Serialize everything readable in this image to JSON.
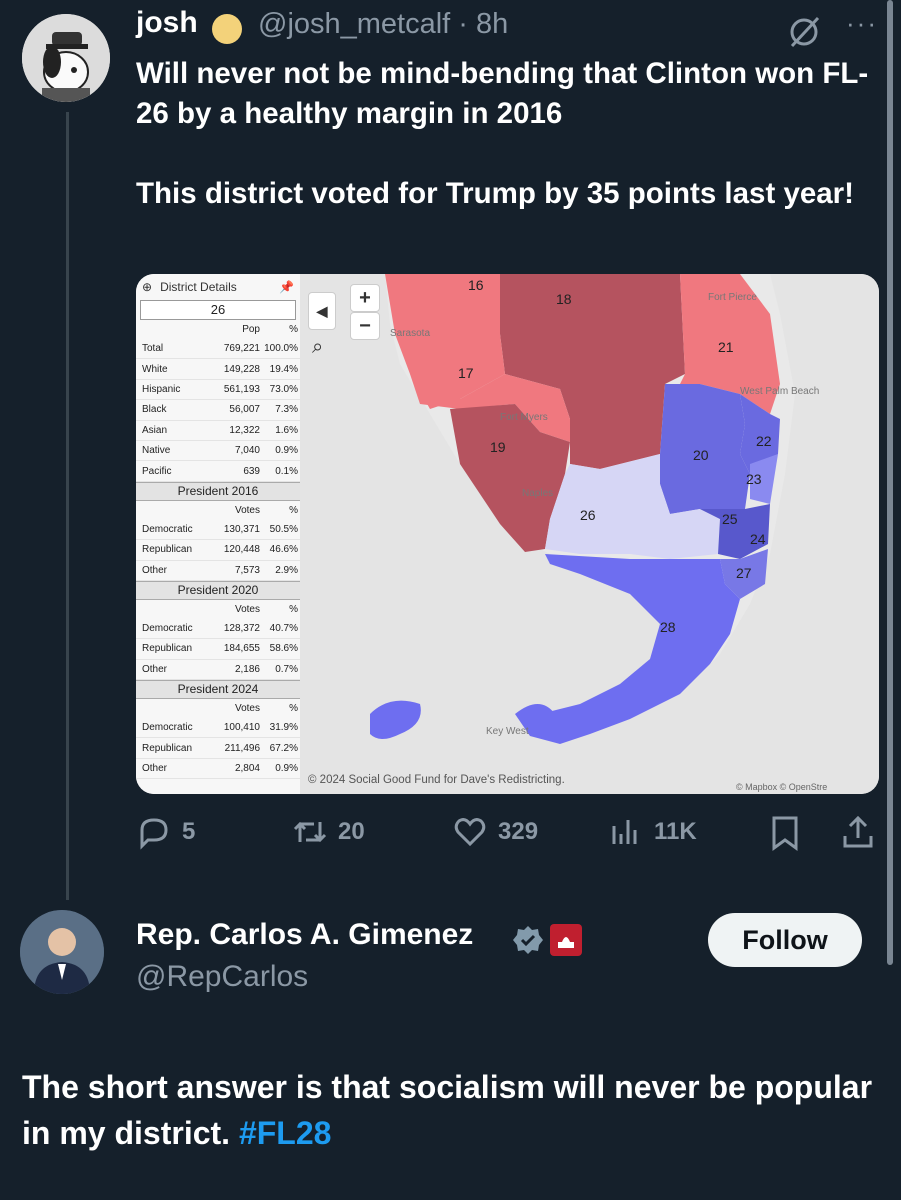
{
  "tweet1": {
    "author_name": "josh",
    "handle_time": "@josh_metcalf · 8h",
    "text": "Will never not be mind-bending that Clinton won FL-26 by a healthy margin in 2016\n\nThis district voted for Trump by 35 points last year!",
    "more_label": "···",
    "actions": {
      "replies": "5",
      "reposts": "20",
      "likes": "329",
      "views": "11K"
    }
  },
  "district_details": {
    "title": "District Details",
    "district": "26",
    "pop_headers": [
      "Pop",
      "%"
    ],
    "pop_rows": [
      [
        "Total",
        "769,221",
        "100.0%"
      ],
      [
        "White",
        "149,228",
        "19.4%"
      ],
      [
        "Hispanic",
        "561,193",
        "73.0%"
      ],
      [
        "Black",
        "56,007",
        "7.3%"
      ],
      [
        "Asian",
        "12,322",
        "1.6%"
      ],
      [
        "Native",
        "7,040",
        "0.9%"
      ],
      [
        "Pacific",
        "639",
        "0.1%"
      ]
    ],
    "elections": [
      {
        "title": "President 2016",
        "headers": [
          "Votes",
          "%"
        ],
        "rows": [
          [
            "Democratic",
            "130,371",
            "50.5%"
          ],
          [
            "Republican",
            "120,448",
            "46.6%"
          ],
          [
            "Other",
            "7,573",
            "2.9%"
          ]
        ]
      },
      {
        "title": "President 2020",
        "headers": [
          "Votes",
          "%"
        ],
        "rows": [
          [
            "Democratic",
            "128,372",
            "40.7%"
          ],
          [
            "Republican",
            "184,655",
            "58.6%"
          ],
          [
            "Other",
            "2,186",
            "0.7%"
          ]
        ]
      },
      {
        "title": "President 2024",
        "headers": [
          "Votes",
          "%"
        ],
        "rows": [
          [
            "Democratic",
            "100,410",
            "31.9%"
          ],
          [
            "Republican",
            "211,496",
            "67.2%"
          ],
          [
            "Other",
            "2,804",
            "0.9%"
          ]
        ]
      }
    ]
  },
  "map": {
    "attribution": "© 2024 Social Good Fund for Dave's Redistricting.",
    "mapbox_credit": "© Mapbox © OpenStre",
    "zoom_in": "+",
    "zoom_out": "−",
    "collapse": "◀",
    "district_labels": [
      "16",
      "18",
      "17",
      "21",
      "19",
      "20",
      "22",
      "23",
      "26",
      "25",
      "24",
      "27",
      "28"
    ],
    "place_labels": [
      "Sarasota",
      "Fort Pierce",
      "Fort Myers",
      "West Palm Beach",
      "Naples",
      "Key West"
    ],
    "colors": {
      "republican_strong": "#b5535f",
      "republican": "#f0787f",
      "democrat": "#6a6ae0",
      "democrat_light": "#d6d6f5",
      "land": "#e9e9e9",
      "water": "#e4e4e4"
    }
  },
  "tweet2": {
    "author_name": "Rep. Carlos A. Gimenez",
    "handle": "@RepCarlos",
    "follow_label": "Follow",
    "text": "The short answer is that socialism will never be popular in my district. ",
    "hashtag": "#FL28"
  }
}
